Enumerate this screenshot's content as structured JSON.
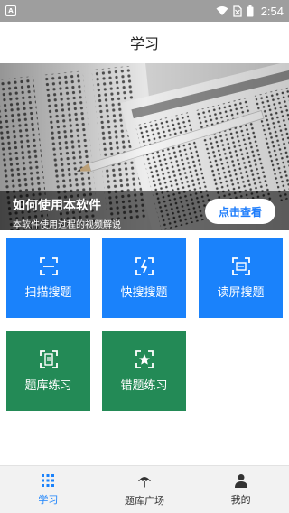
{
  "status_bar": {
    "time": "2:54",
    "app_icon_letter": "A"
  },
  "top_bar": {
    "title": "学习"
  },
  "banner": {
    "title": "如何使用本软件",
    "subtitle": "本软件使用过程的视频解说",
    "button_label": "点击查看"
  },
  "tiles": [
    {
      "label": "扫描搜题",
      "icon": "scan-icon",
      "color": "#1a82fb"
    },
    {
      "label": "快搜搜题",
      "icon": "quick-search-icon",
      "color": "#1a82fb"
    },
    {
      "label": "读屏搜题",
      "icon": "screen-read-icon",
      "color": "#1a82fb"
    },
    {
      "label": "题库练习",
      "icon": "question-bank-icon",
      "color": "#238a56"
    },
    {
      "label": "错题练习",
      "icon": "wrong-questions-icon",
      "color": "#238a56"
    }
  ],
  "tab_bar": {
    "items": [
      {
        "label": "学习",
        "icon": "grid-icon",
        "active": true
      },
      {
        "label": "题库广场",
        "icon": "hat-icon",
        "active": false
      },
      {
        "label": "我的",
        "icon": "person-icon",
        "active": false
      }
    ],
    "active_color": "#1a82fb"
  }
}
